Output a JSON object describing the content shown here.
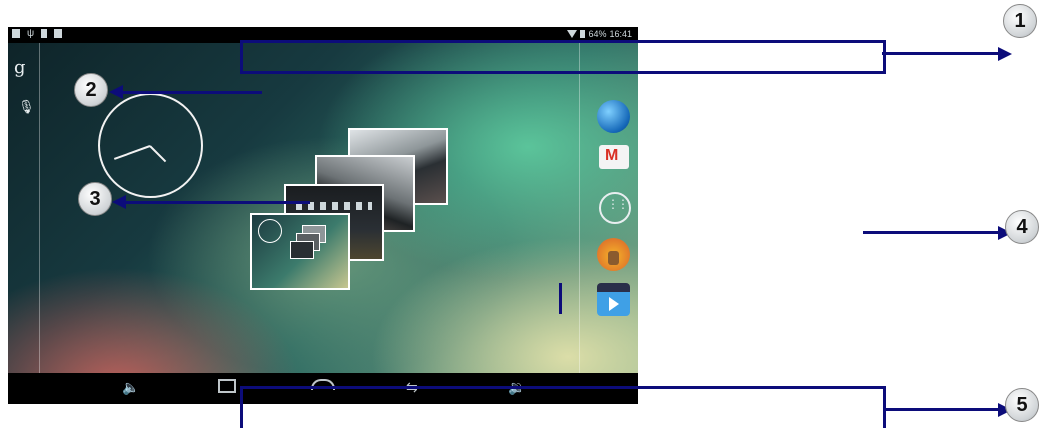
{
  "status_bar": {
    "battery": "64%",
    "time": "16:41",
    "left_icons": [
      "screenshot-icon",
      "usb-icon",
      "sd-card-icon",
      "storage-icon"
    ],
    "right_icons": [
      "wifi-icon",
      "battery-icon"
    ]
  },
  "search_bar": {
    "google_icon": "g",
    "voice_icon": "mic-icon"
  },
  "home": {
    "clock_widget": "analog-clock",
    "recent_apps": [
      "thumb-1",
      "thumb-2",
      "thumb-3",
      "thumb-4"
    ]
  },
  "dock": {
    "items": [
      "browser-icon",
      "gmail-icon",
      "app-drawer-icon",
      "music-icon",
      "video-icon"
    ]
  },
  "nav_bar": {
    "items": [
      "volume-down-icon",
      "recent-apps-icon",
      "home-icon",
      "back-icon",
      "volume-up-icon"
    ]
  },
  "callouts": [
    "1",
    "2",
    "3",
    "4",
    "5"
  ],
  "colors": {
    "annotation": "#0c0c7a",
    "status_bar_bg": "#000000",
    "nav_bar_bg": "#000000"
  }
}
